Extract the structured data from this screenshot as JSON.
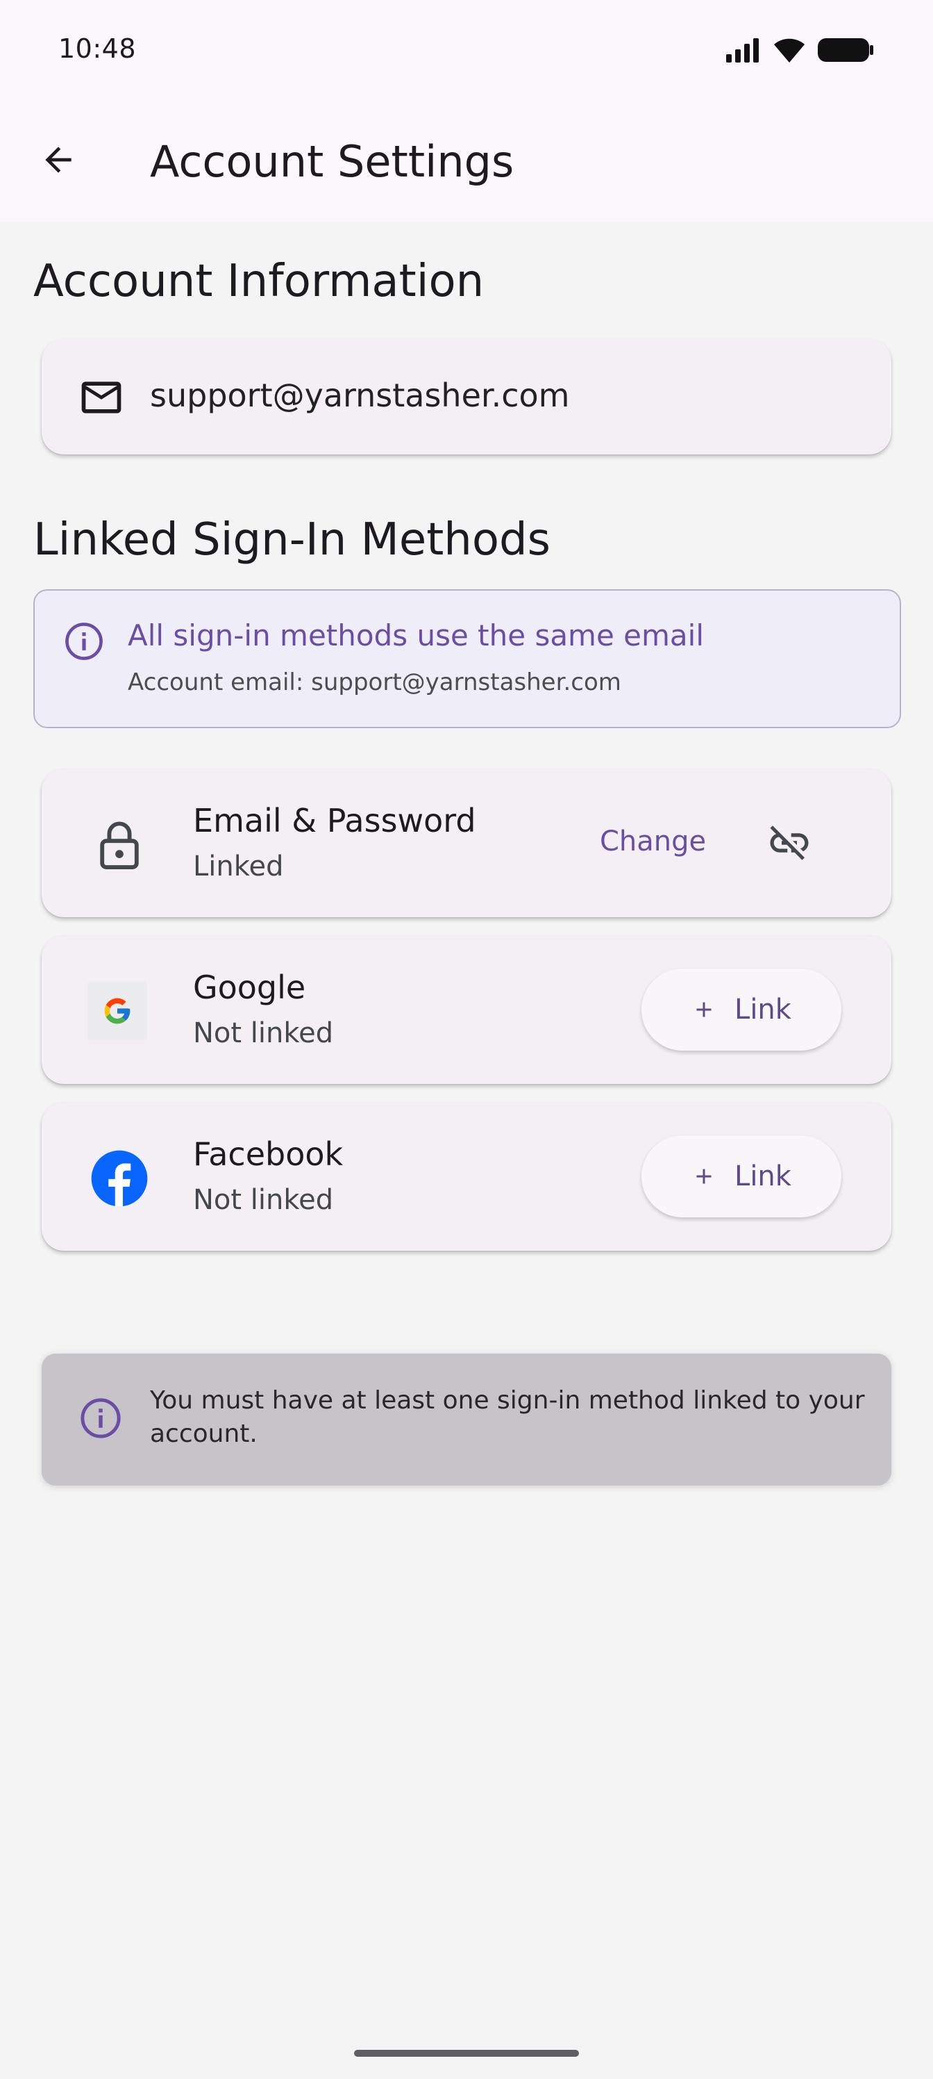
{
  "status_bar": {
    "time": "10:48"
  },
  "app_bar": {
    "title": "Account Settings"
  },
  "account_info": {
    "heading": "Account Information",
    "email": "support@yarnstasher.com"
  },
  "linked_methods": {
    "heading": "Linked Sign-In Methods",
    "info_headline": "All sign-in methods use the same email",
    "info_sub": "Account email: support@yarnstasher.com",
    "items": [
      {
        "name": "Email & Password",
        "state": "Linked",
        "action_label": "Change",
        "icon": "lock-icon"
      },
      {
        "name": "Google",
        "state": "Not linked",
        "action_label": "Link",
        "icon": "google-logo"
      },
      {
        "name": "Facebook",
        "state": "Not linked",
        "action_label": "Link",
        "icon": "facebook-logo"
      }
    ]
  },
  "notice": {
    "text": "You must have at least one sign-in method linked to your account."
  },
  "colors": {
    "accent": "#6a4ea6",
    "facebook": "#0866ff"
  }
}
